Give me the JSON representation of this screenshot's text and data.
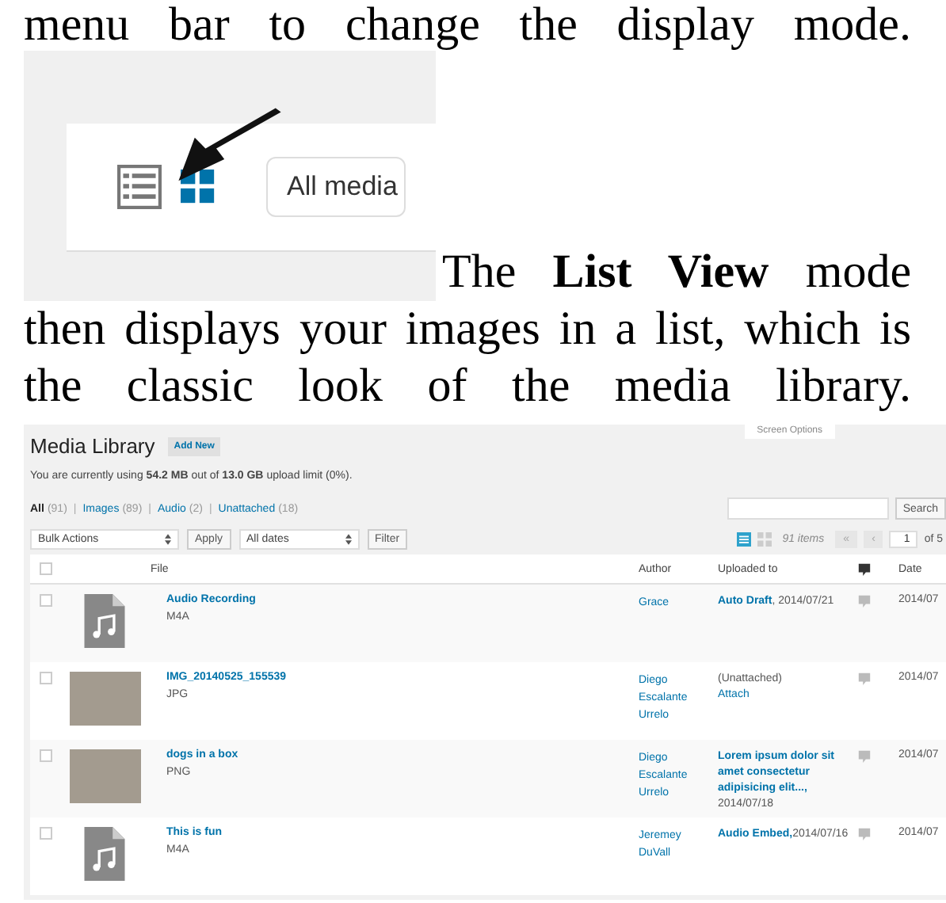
{
  "document": {
    "lead_line": "menu bar to change the display mode.",
    "figure": {
      "view_buttons": [
        {
          "kind": "list",
          "selected": false
        },
        {
          "kind": "grid",
          "selected": true
        }
      ],
      "filter": "All media"
    },
    "paragraph": "The **List View** mode then displays your images in a list, which is the classic look of the media library."
  },
  "media_library": {
    "title": "Media Library",
    "add_new": "Add New",
    "screen_options": "Screen Options",
    "usage": "You are currently using **54.2 MB** out of **13.0 GB** upload limit (0%).",
    "filters": [
      {
        "label": "All",
        "count": "(91)",
        "selected": true
      },
      {
        "separator": "|",
        "label": "Images",
        "count": "(89)",
        "selected": false
      },
      {
        "separator": "|",
        "label": "Audio",
        "count": "(2)",
        "selected": false
      },
      {
        "separator": "|",
        "label": "Unattached",
        "count": "(18)",
        "selected": false
      }
    ],
    "select_all_checked": false,
    "search_button": "Search",
    "bulk_actions": "Bulk Actions",
    "apply": "Apply",
    "dates": "All dates",
    "filter": "Filter",
    "view_buttons": [
      {
        "kind": "list",
        "selected": true
      },
      {
        "kind": "grid",
        "selected": false
      }
    ],
    "items_count": "91 items",
    "pager": {
      "first": "«",
      "prev": "‹",
      "page": "1",
      "total": "of 5"
    },
    "columns": {
      "file": "File",
      "author": "Author",
      "uploaded": "Uploaded to",
      "date": "Date"
    },
    "rows": [
      {
        "checked": false,
        "kind": "audio",
        "title": "Audio Recording",
        "ext": "M4A",
        "author": "Grace",
        "uploaded": {
          "kind": "post",
          "link": "Auto Draft",
          "date": ", 2014/07/21"
        },
        "date": "2014/07"
      },
      {
        "checked": false,
        "kind": "photo",
        "title": "IMG_20140525_155539",
        "ext": "JPG",
        "author": "Diego Escalante Urrelo",
        "uploaded": {
          "kind": "unattached",
          "status": "(Unattached)",
          "action": "Attach"
        },
        "date": "2014/07"
      },
      {
        "checked": false,
        "kind": "photo",
        "title": "dogs in a box",
        "ext": "PNG",
        "author": "Diego Escalante Urrelo",
        "uploaded": {
          "kind": "post",
          "link": "Lorem ipsum dolor sit amet consectetur adipisicing elit...,",
          "date": "2014/07/18"
        },
        "date": "2014/07"
      },
      {
        "checked": false,
        "kind": "audio",
        "title": "This is fun",
        "ext": "M4A",
        "author": "Jeremey DuVall",
        "uploaded": {
          "kind": "post",
          "link": "Audio Embed,",
          "date": "2014/07/16"
        },
        "date": "2014/07"
      }
    ]
  }
}
